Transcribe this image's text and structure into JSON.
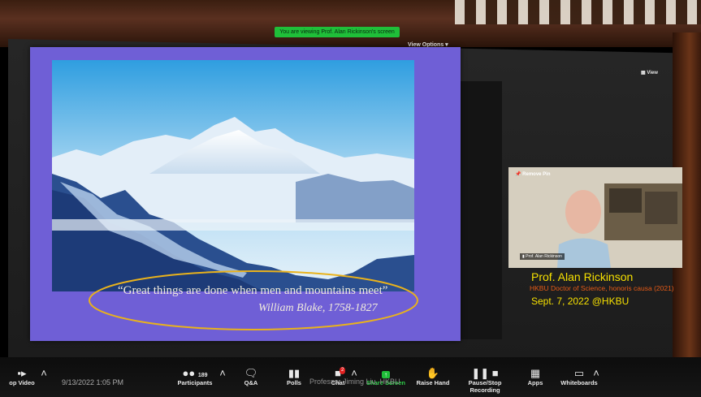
{
  "banner": {
    "text": "You are viewing Prof. Alan Rickinson's screen"
  },
  "view_options": {
    "label": "View Options"
  },
  "view_toggle": {
    "label": "View"
  },
  "slide": {
    "quote": "“Great things are done when men and mountains meet”",
    "attribution": "William Blake, 1758-1827"
  },
  "video": {
    "remove_pin": "Remove Pin",
    "name_tag": "Prof. Alan Rickinson"
  },
  "caption": {
    "name": "Prof. Alan Rickinson",
    "degree": "HKBU Doctor of Science, honoris causa (2021)",
    "date": "Sept. 7, 2022 @HKBU"
  },
  "toolbar": {
    "stop_video": "op Video",
    "timestamp": "9/13/2022 1:05 PM",
    "participants": "Participants",
    "participant_count": "189",
    "qa": "Q&A",
    "polls": "Polls",
    "chat": "Chat",
    "chat_badge": "2",
    "share_screen": "Share Screen",
    "raise_hand": "Raise Hand",
    "recording": "Pause/Stop Recording",
    "apps": "Apps",
    "whiteboards": "Whiteboards"
  },
  "watermark": "Professor Jiming Liu, HKBU",
  "colors": {
    "zoom_green": "#1fbf39",
    "slide_purple": "#6f5fd6",
    "caption_yellow": "#f6e000",
    "caption_orange": "#e65a16",
    "ellipse_gold": "#e9b21c"
  }
}
